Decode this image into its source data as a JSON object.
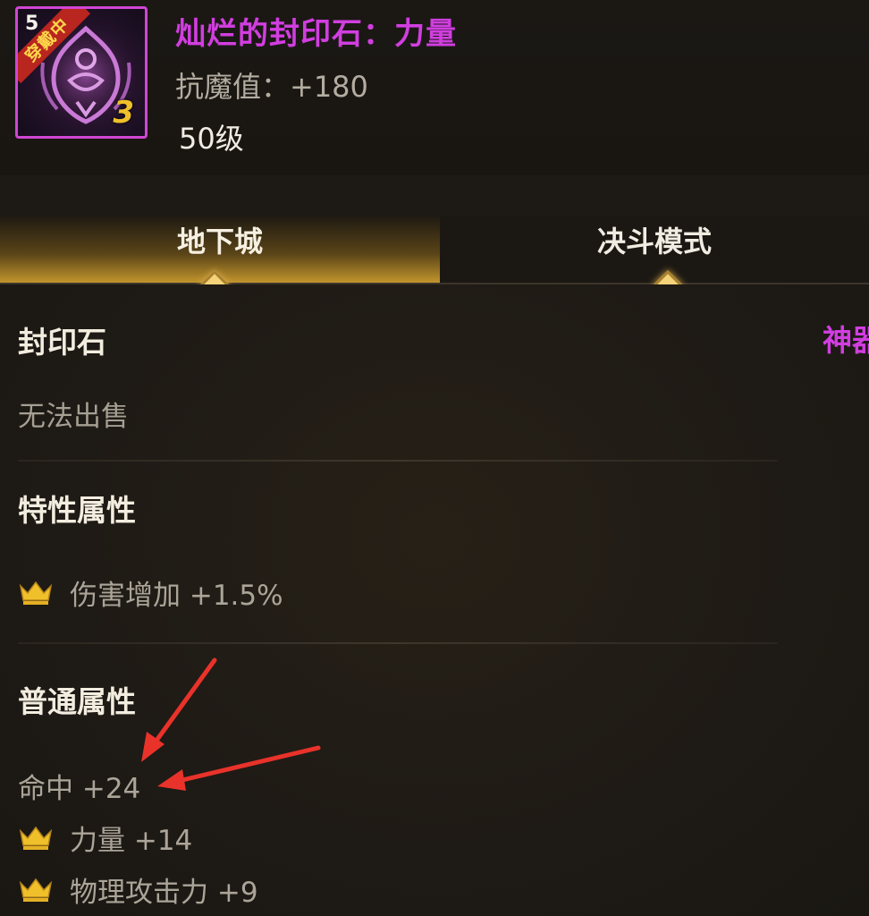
{
  "item": {
    "name": "灿烂的封印石：力量",
    "stat": "抗魔值：+180",
    "level": "50级",
    "corner_number": "5",
    "equip_badge": "穿戴中",
    "grade": "3",
    "frame_color": "#d046d4",
    "icon": "seal-stone-icon"
  },
  "tabs": [
    {
      "label": "地下城",
      "active": true
    },
    {
      "label": "决斗模式",
      "active": false
    }
  ],
  "details": {
    "category": "封印石",
    "type_tag": "神器",
    "sell_status": "无法出售",
    "trait_title": "特性属性",
    "trait_attrs": [
      {
        "text": "伤害增加 +1.5%",
        "icon": "crown-icon"
      }
    ],
    "normal_title": "普通属性",
    "normal_attrs": [
      {
        "text": "命中 +24",
        "icon": ""
      },
      {
        "text": "力量 +14",
        "icon": "crown-icon"
      },
      {
        "text": "物理攻击力 +9",
        "icon": "crown-icon"
      }
    ]
  },
  "colors": {
    "epic_purple": "#d13ee0",
    "tab_gold": "#c89a2e",
    "crown_gold": "#f0c02a",
    "arrow_red": "#e8322a"
  }
}
